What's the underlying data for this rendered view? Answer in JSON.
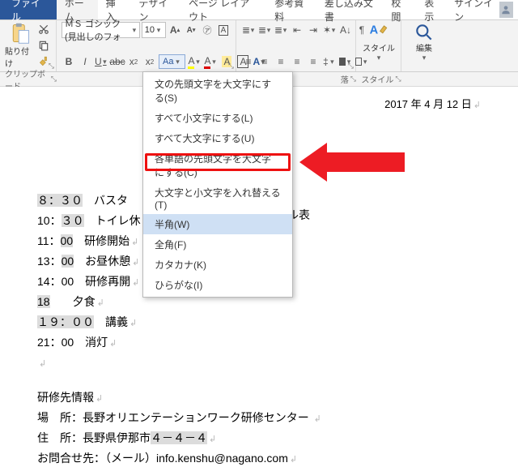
{
  "tabs": {
    "file": "ファイル",
    "home": "ホーム",
    "insert": "挿入",
    "design": "デザイン",
    "layout": "ページ レイアウト",
    "references": "参考資料",
    "mailings": "差し込み文書",
    "review": "校閲",
    "view": "表示",
    "signin": "サインイン"
  },
  "ribbon": {
    "clipboard": {
      "label": "クリップボード",
      "paste": "貼り付け"
    },
    "font": {
      "name": "ＭＳ ゴシック (見出しのフォ",
      "size": "10",
      "change_case": "Aa"
    },
    "paragraph": {
      "label": "落"
    },
    "styles": {
      "button": "スタイル",
      "label": "スタイル"
    },
    "editing": {
      "button": "編集"
    }
  },
  "menu": {
    "sentence_case": "文の先頭文字を大文字にする(S)",
    "lowercase": "すべて小文字にする(L)",
    "uppercase": "すべて大文字にする(U)",
    "capitalize_each": "各単語の先頭文字を大文字にする(C)",
    "toggle_case": "大文字と小文字を入れ替える(T)",
    "half_width": "半角(W)",
    "full_width": "全角(F)",
    "katakana": "カタカナ(K)",
    "hiragana": "ひらがな(I)"
  },
  "doc": {
    "date": "2017 年 4 月 12 日",
    "title_fragment": "ル表",
    "schedule": [
      {
        "time_hl": "８：３０",
        "rest": "　バスタ"
      },
      {
        "pre": "10：",
        "hl": "３０",
        "rest": "　トイレ休"
      },
      {
        "pre": "11：",
        "hl": "00",
        "rest": "　研修開始"
      },
      {
        "pre": "13：",
        "hl": "00",
        "rest": "　お昼休憩"
      },
      {
        "pre": "14：00　研修再開"
      },
      {
        "pre": "18",
        "rest": "　　夕食"
      },
      {
        "time_hl": "１９：００",
        "rest": "　講義"
      },
      {
        "pre": "21：00　消灯"
      }
    ],
    "info_header": "研修先情報",
    "place_label": "場　所：",
    "place_value": "長野オリエンテーションワーク研修センター",
    "address_label": "住　所：",
    "address_value_pre": "長野県伊那市",
    "address_value_hl": "４－４－４",
    "contact_label": "お問合せ先：",
    "contact_value": "（メール）info.kenshu@nagano.com"
  }
}
